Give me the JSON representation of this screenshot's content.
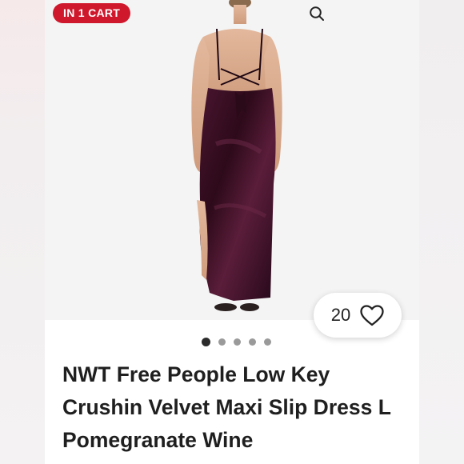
{
  "badge": {
    "label": "IN 1 CART",
    "color": "#d0182c"
  },
  "icons": {
    "search": "search-icon",
    "like": "heart-outline-icon"
  },
  "likes": {
    "count": "20"
  },
  "carousel": {
    "total_dots": 5,
    "active_index": 0
  },
  "listing": {
    "title": "NWT Free People Low Key Crushin Velvet Maxi Slip Dress L Pomegranate Wine"
  },
  "colors": {
    "dress": "#3b0f22",
    "accent": "#d0182c"
  }
}
